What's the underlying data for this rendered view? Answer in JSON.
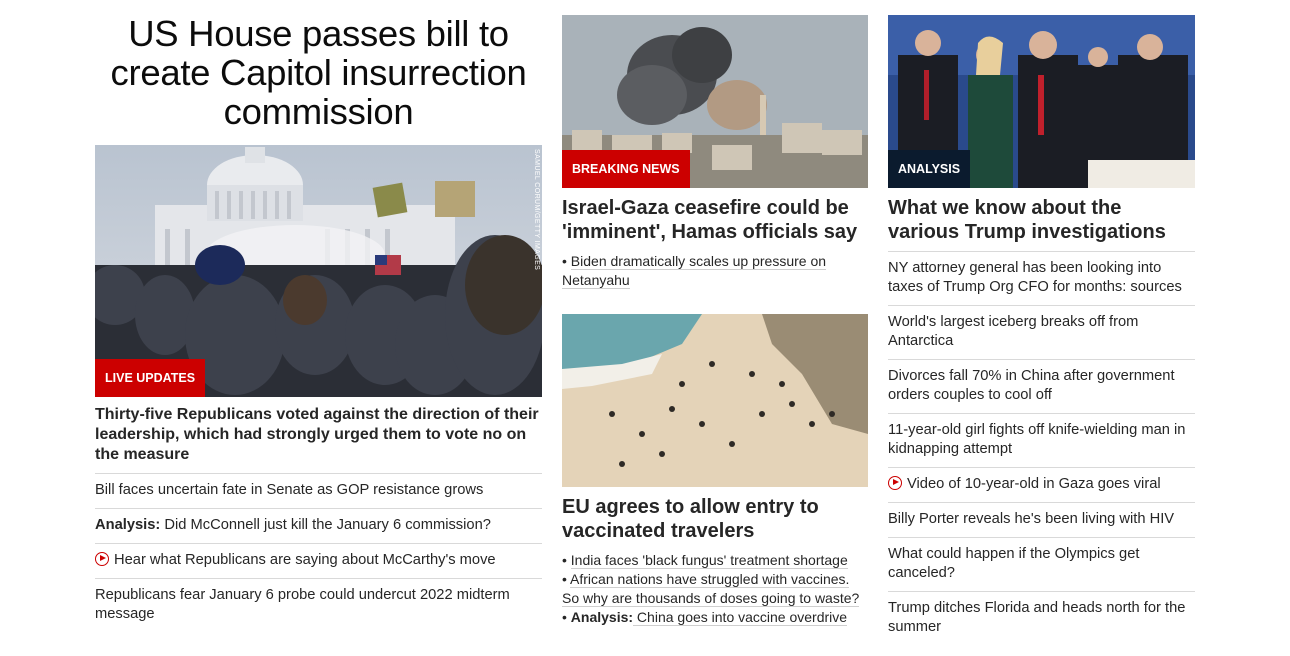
{
  "col1": {
    "headline": "US House passes bill to create Capitol insurrection commission",
    "image_credit": "SAMUEL CORUM/GETTY IMAGES",
    "badge": "LIVE UPDATES",
    "lead": "Thirty-five Republicans voted against the direction of their leadership, which had strongly urged them to vote no on the measure",
    "links": [
      {
        "prefix": "",
        "text": "Bill faces uncertain fate in Senate as GOP resistance grows"
      },
      {
        "prefix": "Analysis:",
        "text": " Did McConnell just kill the January 6 commission?"
      },
      {
        "prefix": "",
        "text": "Hear what Republicans are saying about McCarthy's move",
        "video": true
      },
      {
        "prefix": "",
        "text": "Republicans fear January 6 probe could undercut 2022 midterm message"
      }
    ]
  },
  "col2": {
    "card1": {
      "badge": "BREAKING NEWS",
      "title": "Israel-Gaza ceasefire could be 'imminent', Hamas officials say",
      "sublinks": [
        {
          "bullet": "• ",
          "prefix": "",
          "text": "Biden dramatically scales up pressure on Netanyahu"
        }
      ]
    },
    "card2": {
      "title": "EU agrees to allow entry to vaccinated travelers",
      "sublinks": [
        {
          "bullet": "• ",
          "prefix": "",
          "text": "India faces 'black fungus' treatment shortage"
        },
        {
          "bullet": "• ",
          "prefix": "",
          "text": "African nations have struggled with vaccines. So why are thousands of doses going to waste?"
        },
        {
          "bullet": "• ",
          "prefix": "Analysis:",
          "text": " China goes into vaccine overdrive"
        }
      ]
    }
  },
  "col3": {
    "badge": "ANALYSIS",
    "title": "What we know about the various Trump investigations",
    "links": [
      {
        "text": "NY attorney general has been looking into taxes of Trump Org CFO for months: sources"
      },
      {
        "text": "World's largest iceberg breaks off from Antarctica"
      },
      {
        "text": "Divorces fall 70% in China after government orders couples to cool off"
      },
      {
        "text": "11-year-old girl fights off knife-wielding man in kidnapping attempt"
      },
      {
        "text": "Video of 10-year-old in Gaza goes viral",
        "video": true
      },
      {
        "text": "Billy Porter reveals he's been living with HIV"
      },
      {
        "text": "What could happen if the Olympics get canceled?"
      },
      {
        "text": "Trump ditches Florida and heads north for the summer"
      }
    ]
  },
  "colors": {
    "badge_red": "#cc0000",
    "badge_dark": "#0b1b2e",
    "play_icon": "#cc0000"
  }
}
